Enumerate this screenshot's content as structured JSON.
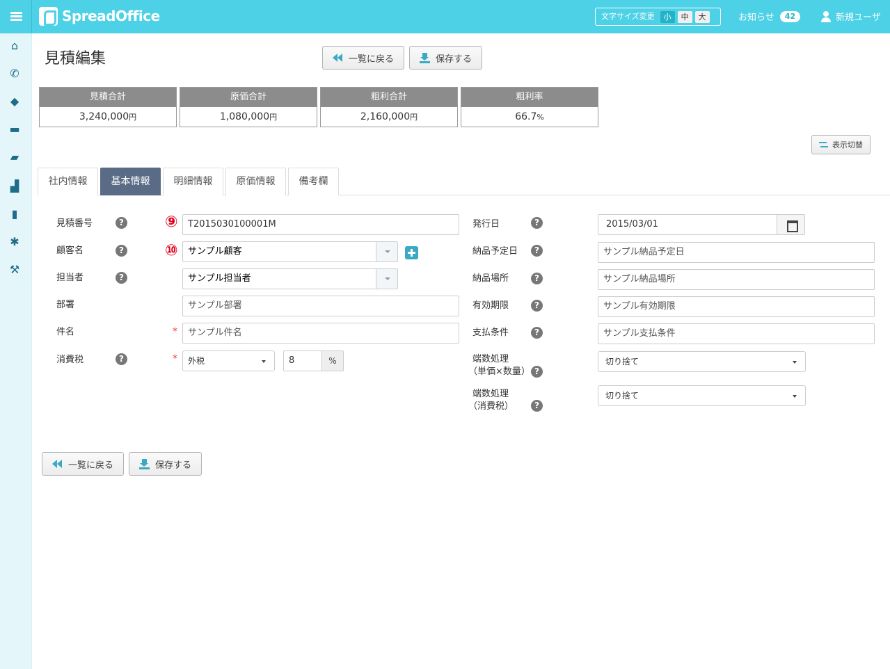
{
  "header": {
    "logo_text": "SpreadOffice",
    "font_size_label": "文字サイズ変更",
    "font_sizes": [
      "小",
      "中",
      "大"
    ],
    "notice_label": "お知らせ",
    "notice_count": "42",
    "user_name": "新規ユーザ"
  },
  "sidebar": {
    "icons": [
      "home-icon",
      "phone-icon",
      "tags-icon",
      "card-icon",
      "folder-icon",
      "chart-icon",
      "file-icon",
      "gear-icon",
      "wrench-icon"
    ]
  },
  "page": {
    "title": "見積編集",
    "back_label": "一覧に戻る",
    "save_label": "保存する",
    "toggle_label": "表示切替"
  },
  "summary": [
    {
      "label": "見積合計",
      "value": "3,240,000",
      "unit": "円"
    },
    {
      "label": "原価合計",
      "value": "1,080,000",
      "unit": "円"
    },
    {
      "label": "粗利合計",
      "value": "2,160,000",
      "unit": "円"
    },
    {
      "label": "粗利率",
      "value": "66.7",
      "unit": "%"
    }
  ],
  "tabs": [
    "社内情報",
    "基本情報",
    "明細情報",
    "原価情報",
    "備考欄"
  ],
  "active_tab": "基本情報",
  "annotations": [
    "⑨",
    "⑩"
  ],
  "left_fields": {
    "estimate_no": {
      "label": "見積番号",
      "value": "T2015030100001M"
    },
    "customer": {
      "label": "顧客名",
      "value": "サンプル顧客"
    },
    "staff": {
      "label": "担当者",
      "value": "サンプル担当者"
    },
    "department": {
      "label": "部署",
      "value": "サンプル部署"
    },
    "subject": {
      "label": "件名",
      "value": "サンプル件名"
    },
    "tax": {
      "label": "消費税",
      "value": "外税",
      "rate": "8",
      "rate_unit": "%"
    }
  },
  "right_fields": {
    "issue_date": {
      "label": "発行日",
      "value": "2015/03/01"
    },
    "delivery_date": {
      "label": "納品予定日",
      "value": "サンプル納品予定日"
    },
    "delivery_place": {
      "label": "納品場所",
      "value": "サンプル納品場所"
    },
    "valid_period": {
      "label": "有効期限",
      "value": "サンプル有効期限"
    },
    "payment_terms": {
      "label": "支払条件",
      "value": "サンプル支払条件"
    },
    "rounding_unit": {
      "label_line1": "端数処理",
      "label_line2": "（単価×数量）",
      "value": "切り捨て"
    },
    "rounding_tax": {
      "label_line1": "端数処理",
      "label_line2": "（消費税）",
      "value": "切り捨て"
    }
  },
  "colors": {
    "topbar": "#4dd1e6",
    "sidebar": "#e4f6fa",
    "active_tab": "#5a6b85",
    "summary_head": "#8c8c8c",
    "accent": "#3aa9c4",
    "required": "#e33333",
    "annotation": "#e0001a"
  }
}
